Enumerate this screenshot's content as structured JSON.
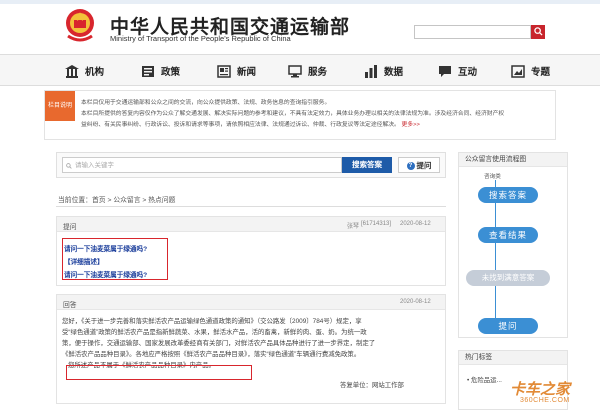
{
  "ministry": {
    "title_cn": "中华人民共和国交通运输部",
    "title_en": "Ministry of Transport of the People's Republic of China",
    "search_icon": "search-icon",
    "top_text": "2020-08-12"
  },
  "nav": {
    "items": [
      {
        "label": "机构",
        "icon": "building-icon"
      },
      {
        "label": "政策",
        "icon": "policy-icon"
      },
      {
        "label": "新闻",
        "icon": "news-icon"
      },
      {
        "label": "服务",
        "icon": "service-icon"
      },
      {
        "label": "数据",
        "icon": "data-icon"
      },
      {
        "label": "互动",
        "icon": "chat-icon"
      },
      {
        "label": "专题",
        "icon": "topic-icon"
      }
    ]
  },
  "notice": {
    "tag": "栏目说明",
    "line1": "本栏目仅用于交通运输部和公众之间的交流，向公众提供政策、法规、政务信息的查询指引服务。",
    "line2": "本栏目所提供的答复内容仅作为公众了解交通发展、解决实际问题的参考和建议，不具有法定效力，具体业务办理以相关的法律法规为准。涉及经济合同、经济财产权",
    "line3": "益纠纷、有关民事纠纷、行政诉讼、投诉和请求等事项，请依照相应法律、法规通过诉讼、仲裁、行政复议等法定途径解决。",
    "more": "更多>>"
  },
  "search": {
    "placeholder": "请输入关键字",
    "search_button": "搜索答案",
    "ask_button": "提问"
  },
  "breadcrumb": {
    "prefix": "当前位置：",
    "home": "首页",
    "sep1": " > ",
    "section": "公众留言",
    "sep2": " > ",
    "current": "热点问题"
  },
  "question": {
    "label": "提问",
    "author": "张琴",
    "id": "[61714313]",
    "date": "2020-08-12",
    "line1": "请问一下油麦菜属于绿通吗?",
    "detail_label": "【详细描述】",
    "line2": "请问一下油麦菜属于绿通吗?"
  },
  "answer": {
    "label": "回答",
    "date": "2020-08-12",
    "p1": "您好，《关于进一步完善和落实鲜活农产品运输绿色通道政策的通知》（交公路发〔2009〕784号）规定，享",
    "p2": "受“绿色通道”政策的鲜活农产品是指新鲜蔬菜、水果，鲜活水产品，活的畜禽，新鲜的肉、蛋、奶。为统一政",
    "p3": "策，便于操作，交通运输部、国家发展改革委经商有关部门，对鲜活农产品具体品种进行了进一步界定，制定了",
    "p4": "《鲜活农产品品种目录》。各地应严格按照《鲜活农产品品种目录》，落实“绿色通道”车辆通行费减免政策。",
    "highlight": "您所述产品不属于《鲜活农产品品种目录》内产品。",
    "source_label": "答复单位：",
    "source": "网站工作部"
  },
  "sidebar": {
    "flow_title": "公众留言使用流程图",
    "flow_top": "咨询类",
    "steps": [
      "搜索答案",
      "查看结果",
      "未找到满意答案",
      "提问"
    ],
    "hot_title": "热门标签",
    "hot_item": "危险品运..."
  },
  "watermark": {
    "main": "卡车之家",
    "sub": "360CHE.COM"
  },
  "colors": {
    "accent_red": "#c8252c",
    "link_blue": "#1a3d9b",
    "flow_blue": "#3b8fd4",
    "flow_disabled": "#c5cdd8",
    "notice_orange": "#e8692e"
  }
}
